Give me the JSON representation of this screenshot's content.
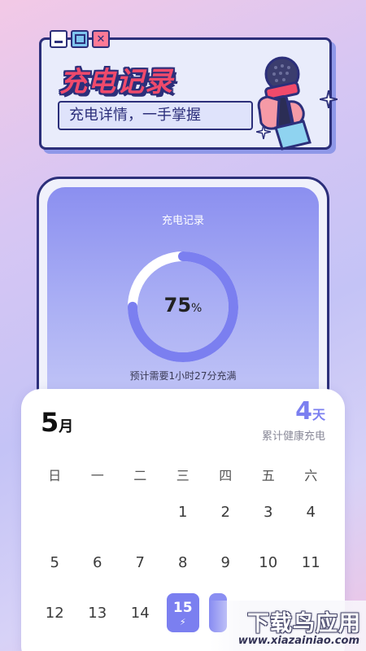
{
  "banner": {
    "title": "充电记录",
    "subtitle": "充电详情，一手掌握",
    "window_controls": [
      "minimize-icon",
      "maximize-icon",
      "close-icon"
    ]
  },
  "charge_card": {
    "title": "充电记录",
    "percent": "75",
    "percent_unit": "%",
    "progress_fraction": 0.75,
    "estimate": "预计需要1小时27分充满"
  },
  "calendar": {
    "month_number": "5",
    "month_unit": "月",
    "days_count": "4",
    "days_unit": "天",
    "days_label": "累计健康充电",
    "weekdays": [
      "日",
      "一",
      "二",
      "三",
      "四",
      "五",
      "六"
    ],
    "rows": [
      [
        "",
        "",
        "",
        "1",
        "2",
        "3",
        "4"
      ],
      [
        "5",
        "6",
        "7",
        "8",
        "9",
        "10",
        "11"
      ],
      [
        "12",
        "13",
        "14",
        "15",
        "",
        "",
        ""
      ]
    ],
    "selected_day": "15",
    "selected_icon": "bolt-icon"
  },
  "watermark": {
    "title": "下载鸟应用",
    "url": "www.xiazainiao.com"
  },
  "colors": {
    "accent": "#7b7ff0",
    "banner_title": "#f04a6b",
    "outline": "#2c2f7a"
  }
}
